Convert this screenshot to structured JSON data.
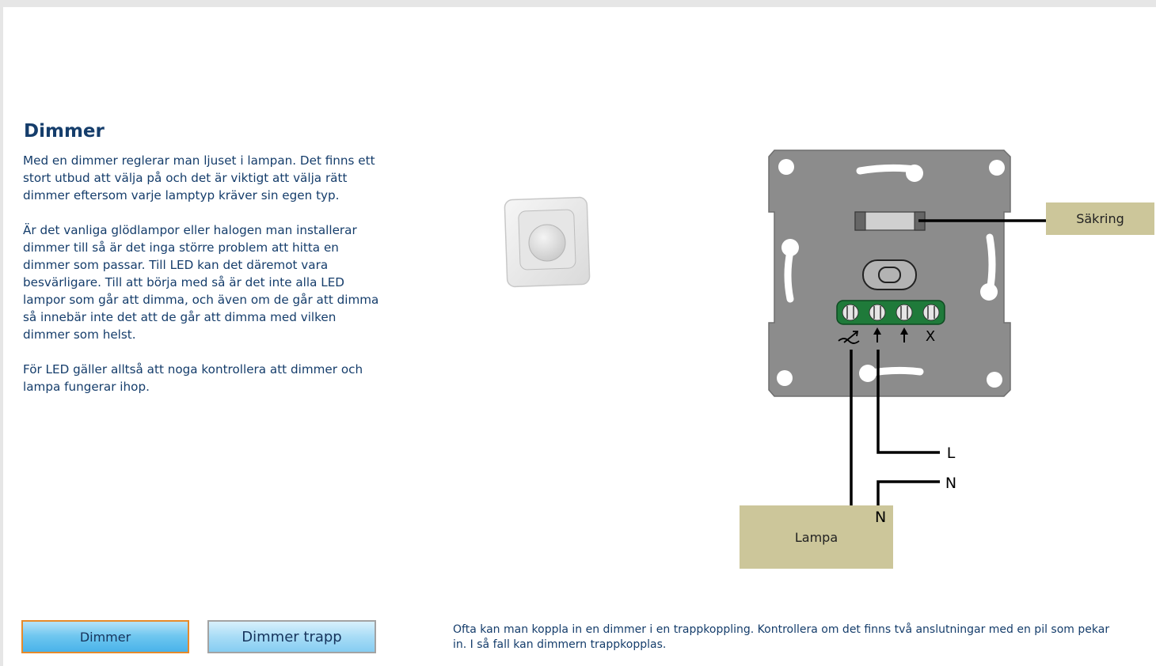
{
  "content": {
    "title": "Dimmer",
    "paragraphs": [
      "Med en dimmer reglerar man ljuset i lampan. Det finns ett stort utbud att välja på och det är viktigt att välja rätt dimmer eftersom varje lamptyp kräver sin egen typ.",
      "Är det vanliga glödlampor eller halogen man installerar dimmer till så är det inga större problem att hitta en dimmer som passar. Till LED kan det däremot vara besvärligare. Till att börja med så är det inte alla LED lampor som går att dimma, och även om de går att dimma så innebär inte det att de går att dimma med vilken dimmer som helst.",
      "För LED gäller alltså att noga kontrollera att dimmer och lampa fungerar ihop."
    ]
  },
  "diagram": {
    "fuse_label": "Säkring",
    "lamp_label": "Lampa",
    "lamp_terminal_label": "N",
    "wire_labels": {
      "live": "L",
      "neutral": "N"
    },
    "terminal_x_label": "X",
    "colors": {
      "plate": "#8c8c8c",
      "terminal_block": "#1f7a3a",
      "label_box": "#ccc69a",
      "wire": "#000000"
    }
  },
  "buttons": {
    "dimmer": "Dimmer",
    "dimmer_trapp": "Dimmer trapp"
  },
  "footnote": "Ofta kan man koppla in en dimmer i en trappkoppling. Kontrollera om det finns två anslutningar med en pil som pekar in. I så fall kan dimmern trappkopplas.",
  "icons": [
    "dimmer-product-image",
    "dimmer-symbol-icon",
    "arrow-in-icon"
  ]
}
